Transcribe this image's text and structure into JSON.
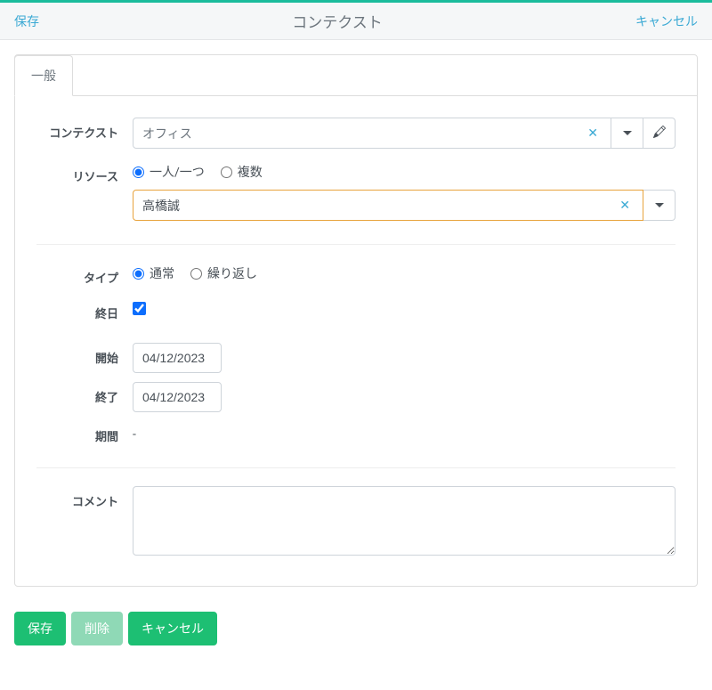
{
  "header": {
    "save": "保存",
    "title": "コンテクスト",
    "cancel": "キャンセル"
  },
  "tabs": [
    {
      "label": "一般"
    }
  ],
  "form": {
    "context": {
      "label": "コンテクスト",
      "value": "オフィス"
    },
    "resource": {
      "label": "リソース",
      "options": [
        {
          "label": "一人/一つ",
          "checked": true
        },
        {
          "label": "複数",
          "checked": false
        }
      ],
      "selected_value": "高橋誠"
    },
    "type": {
      "label": "タイプ",
      "options": [
        {
          "label": "通常",
          "checked": true
        },
        {
          "label": "繰り返し",
          "checked": false
        }
      ]
    },
    "allday": {
      "label": "終日",
      "checked": true
    },
    "start": {
      "label": "開始",
      "value": "04/12/2023"
    },
    "end": {
      "label": "終了",
      "value": "04/12/2023"
    },
    "duration": {
      "label": "期間",
      "value": "-"
    },
    "comment": {
      "label": "コメント",
      "value": ""
    }
  },
  "footer": {
    "save": "保存",
    "delete": "削除",
    "cancel": "キャンセル"
  },
  "colors": {
    "accent": "#1abc9c",
    "link": "#3aa9d4",
    "highlight_border": "#e8a33d",
    "button_primary": "#1dbf73"
  }
}
